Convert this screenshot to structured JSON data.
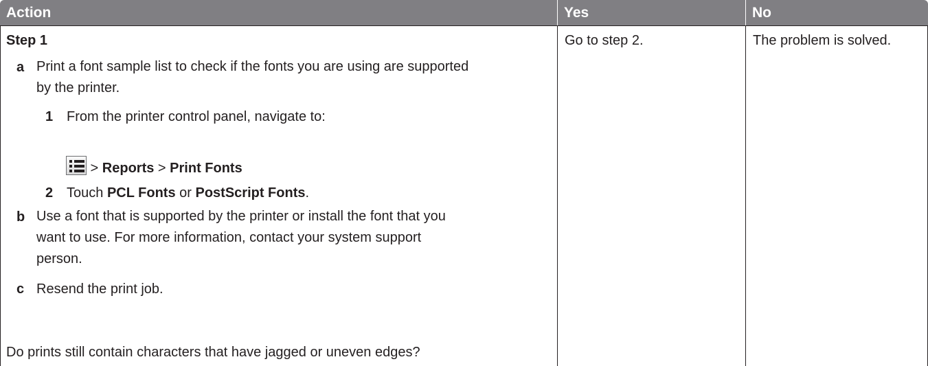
{
  "table": {
    "headers": {
      "action": "Action",
      "yes": "Yes",
      "no": "No"
    },
    "step_title": "Step 1",
    "items": [
      {
        "letter": "a",
        "lines": [
          "Print a font sample list to check if the fonts you are using are supported",
          "by the printer."
        ]
      },
      {
        "letter": "b",
        "lines": [
          "Use a font that is supported by the printer or install the font that you",
          "want to use. For more information, contact your system support",
          "person."
        ]
      },
      {
        "letter": "c",
        "lines": [
          "Resend the print job."
        ]
      }
    ],
    "substeps": [
      {
        "num": "1",
        "text": "From the printer control panel, navigate to:"
      },
      {
        "num": "2",
        "pre": "Touch ",
        "b1": "PCL Fonts",
        "mid": " or ",
        "b2": "PostScript Fonts",
        "post": "."
      }
    ],
    "nav_path": {
      "sep1": " > ",
      "reports": "Reports",
      "sep2": " > ",
      "print_fonts": "Print Fonts"
    },
    "question": "Do prints still contain characters that have jagged or uneven edges?",
    "yes_text": "Go to step 2.",
    "no_text": "The problem is solved.",
    "icon": "menu-list-icon"
  }
}
